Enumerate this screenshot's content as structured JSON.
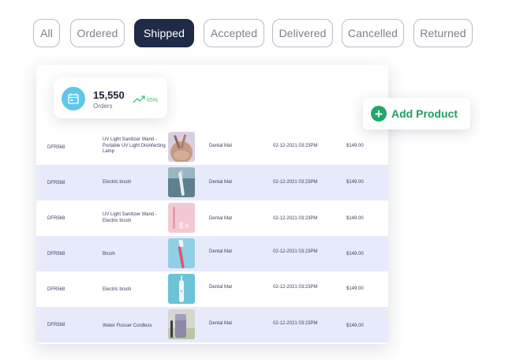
{
  "tabs": [
    {
      "label": "All",
      "active": false
    },
    {
      "label": "Ordered",
      "active": false
    },
    {
      "label": "Shipped",
      "active": true
    },
    {
      "label": "Accepted",
      "active": false
    },
    {
      "label": "Delivered",
      "active": false
    },
    {
      "label": "Cancelled",
      "active": false
    },
    {
      "label": "Returned",
      "active": false
    }
  ],
  "stat": {
    "value": "15,550",
    "label": "Orders",
    "trend": "65%",
    "icon": "calendar-icon",
    "trend_icon": "trending-up-icon"
  },
  "add_product": {
    "label": "Add Product",
    "icon": "plus-icon"
  },
  "orders": [
    {
      "id": "DFR568",
      "name": "UV Light Sanitizer Wand - Portable UV Light Disinfecting Lamp",
      "image": "sanitizer-wand-image",
      "category": "Dental Mat",
      "date": "02-12-2021 03:23PM",
      "price": "$149.00"
    },
    {
      "id": "DFR568",
      "name": "Electric brush",
      "image": "electric-brush-image",
      "category": "Dental Mat",
      "date": "02-12-2021 03:23PM",
      "price": "$149.00"
    },
    {
      "id": "DFR568",
      "name": "UV Light Sanitizer Wand - Electric brush",
      "image": "pink-brush-image",
      "category": "Dental Mat",
      "date": "02-12-2021 03:23PM",
      "price": "$149.00"
    },
    {
      "id": "DFR568",
      "name": "Brush",
      "image": "toothbrush-image",
      "category": "Dental Mat",
      "date": "02-12-2021 03:23PM",
      "price": "$149.00"
    },
    {
      "id": "DFR568",
      "name": "Electric brush",
      "image": "teal-electric-brush-image",
      "category": "Dental Mat",
      "date": "02-12-2021 03:23PM",
      "price": "$149.00"
    },
    {
      "id": "DFR568",
      "name": "Water Flosser Cordless",
      "image": "water-flosser-image",
      "category": "Dental Mat",
      "date": "02-12-2021 03:23PM",
      "price": "$149.00"
    }
  ],
  "colors": {
    "active_tab": "#1e2a46",
    "row_alt": "#e7eafb",
    "accent_green": "#1fa86a",
    "stat_icon_bg": "#5fc8ea",
    "trend_green": "#3ec37c"
  }
}
